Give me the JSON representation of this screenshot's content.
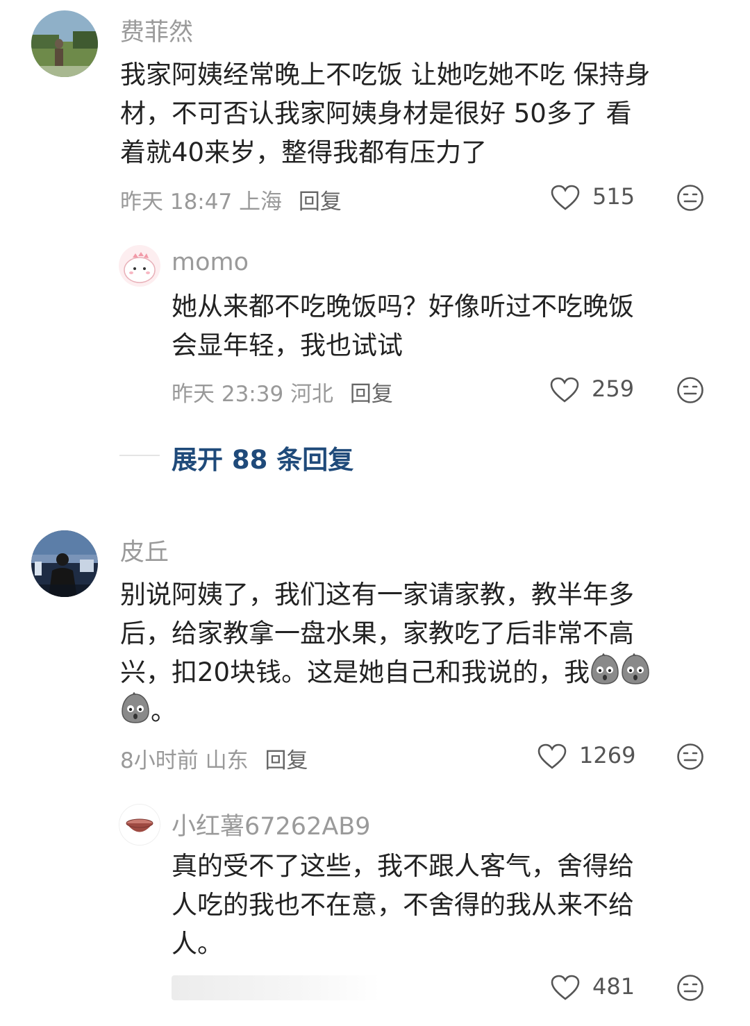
{
  "comments": [
    {
      "user": "费菲然",
      "lines": [
        "我家阿姨经常晚上不吃饭 让她吃她不吃 保持身",
        "材，不可否认我家阿姨身材是很好 50多了 看",
        "着就40来岁，整得我都有压力了"
      ],
      "time": "昨天 18:47",
      "location": "上海",
      "reply_label": "回复",
      "likes": "515",
      "avatar_icon": "outdoor-photo-avatar"
    },
    {
      "user": "momo",
      "lines": [
        "她从来都不吃晚饭吗？好像听过不吃晚饭",
        "会显年轻，我也试试"
      ],
      "time": "昨天 23:39",
      "location": "河北",
      "reply_label": "回复",
      "likes": "259",
      "avatar_icon": "cartoon-dino-avatar"
    },
    {
      "user": "皮丘",
      "lines": [
        "别说阿姨了，我们这有一家请家教，教半年多",
        "后，给家教拿一盘水果，家教吃了后非常不高",
        "兴，扣20块钱。这是她自己和我说的，我"
      ],
      "tail": "。",
      "time": "8小时前",
      "location": "山东",
      "reply_label": "回复",
      "likes": "1269",
      "avatar_icon": "night-city-avatar"
    },
    {
      "user": "小红薯67262AB9",
      "lines": [
        "真的受不了这些，我不跟人客气，舍得给",
        "人吃的我也不在意，不舍得的我从来不给",
        "人。"
      ],
      "likes": "481",
      "avatar_icon": "bowl-avatar"
    }
  ],
  "expand_replies": "展开 88 条回复",
  "icons": {
    "like": "heart-outline-icon",
    "emoji": "neutral-face-icon",
    "sticker": "potato-shocked-sticker"
  },
  "colors": {
    "name": "#9a9a9a",
    "link": "#1f4a7a",
    "meta": "#999999"
  }
}
